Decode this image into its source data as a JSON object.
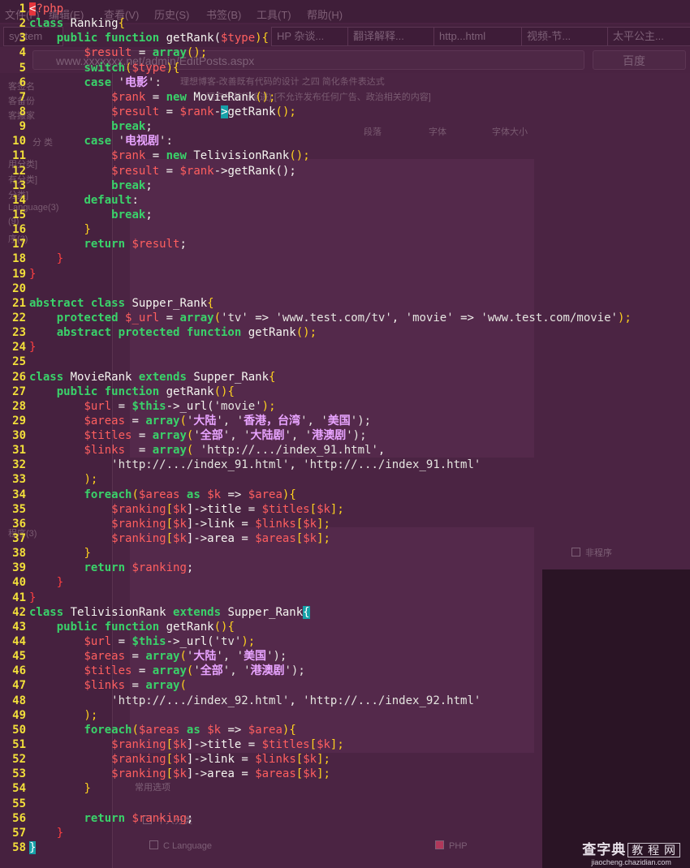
{
  "background": {
    "menus": [
      "文件(F)",
      "编辑(E)",
      "查看(V)",
      "历史(S)",
      "书签(B)",
      "工具(T)",
      "帮助(H)"
    ],
    "tabs": [
      "system",
      "HP 杂谈...",
      "翻译解释...",
      "http...html",
      "视频-节...",
      "太平公主..."
    ],
    "url": "www.xxxxxxx.net/admin/EditPosts.aspx",
    "search_placeholder": "百度",
    "sidebar_items": [
      "客签名",
      "客备份",
      "客搬家",
      "分    类",
      "用分类]",
      "有分类]",
      "分类]",
      "Language(3)",
      "(9)",
      "序(3)",
      "程序(3)"
    ],
    "editor_title": "理想博客-改善既有代码的设计 之四 简化条件表达式",
    "editor_notice": "理产生首行缩进) [不允许发布任何广告、政治相关的内容]",
    "editor_dropdowns": [
      "段落",
      "字体",
      "字体大小"
    ],
    "options_heading": "常用选项",
    "options": [
      "非程序",
      "个人分类",
      "C Language",
      "PHP"
    ]
  },
  "code_lines": [
    {
      "n": "1"
    },
    {
      "n": "2"
    },
    {
      "n": "3"
    },
    {
      "n": "4"
    },
    {
      "n": "5"
    },
    {
      "n": "6"
    },
    {
      "n": "7"
    },
    {
      "n": "8"
    },
    {
      "n": "9"
    },
    {
      "n": "10"
    },
    {
      "n": "11"
    },
    {
      "n": "12"
    },
    {
      "n": "13"
    },
    {
      "n": "14"
    },
    {
      "n": "15"
    },
    {
      "n": "16"
    },
    {
      "n": "17"
    },
    {
      "n": "18"
    },
    {
      "n": "19"
    },
    {
      "n": "20"
    },
    {
      "n": "21"
    },
    {
      "n": "22"
    },
    {
      "n": "23"
    },
    {
      "n": "24"
    },
    {
      "n": "25"
    },
    {
      "n": "26"
    },
    {
      "n": "27"
    },
    {
      "n": "28"
    },
    {
      "n": "29"
    },
    {
      "n": "30"
    },
    {
      "n": "31"
    },
    {
      "n": "32"
    },
    {
      "n": "33"
    },
    {
      "n": "34"
    },
    {
      "n": "35"
    },
    {
      "n": "36"
    },
    {
      "n": "37"
    },
    {
      "n": "38"
    },
    {
      "n": "39"
    },
    {
      "n": "40"
    },
    {
      "n": "41"
    },
    {
      "n": "42"
    },
    {
      "n": "43"
    },
    {
      "n": "44"
    },
    {
      "n": "45"
    },
    {
      "n": "46"
    },
    {
      "n": "47"
    },
    {
      "n": "48"
    },
    {
      "n": "49"
    },
    {
      "n": "50"
    },
    {
      "n": "51"
    },
    {
      "n": "52"
    },
    {
      "n": "53"
    },
    {
      "n": "54"
    },
    {
      "n": "55"
    },
    {
      "n": "56"
    },
    {
      "n": "57"
    },
    {
      "n": "58"
    }
  ],
  "code": {
    "l1": [
      "<",
      "?php"
    ],
    "l2": [
      "class ",
      "Ranking",
      "{"
    ],
    "l3": [
      "    ",
      "public function ",
      "getRank(",
      "$type",
      "){"
    ],
    "l4": [
      "        ",
      "$result",
      " = ",
      "array",
      "();"
    ],
    "l5": [
      "        ",
      "switch",
      "(",
      "$type",
      "){"
    ],
    "l6": [
      "        ",
      "case ",
      "'",
      "电影",
      "':"
    ],
    "l7": [
      "            ",
      "$rank",
      " = ",
      "new ",
      "MovieRank",
      "();"
    ],
    "l8": [
      "            ",
      "$result",
      " = ",
      "$rank",
      "-",
      ">",
      "getRank",
      "();"
    ],
    "l9": [
      "            ",
      "break",
      ";"
    ],
    "l10": [
      "        ",
      "case ",
      "'",
      "电视剧",
      "':"
    ],
    "l11": [
      "            ",
      "$rank",
      " = ",
      "new ",
      "TelivisionRank",
      "();"
    ],
    "l12": [
      "            ",
      "$result",
      " = ",
      "$rank",
      "->getRank();"
    ],
    "l13": [
      "            ",
      "break",
      ";"
    ],
    "l14": [
      "        ",
      "default",
      ":"
    ],
    "l15": [
      "            ",
      "break",
      ";"
    ],
    "l16": [
      "        ",
      "}"
    ],
    "l17": [
      "        ",
      "return ",
      "$result",
      ";"
    ],
    "l18": [
      "    ",
      "}"
    ],
    "l19": [
      "}"
    ],
    "l20": [
      ""
    ],
    "l21": [
      "abstract class ",
      "Supper_Rank",
      "{"
    ],
    "l22": [
      "    ",
      "protected ",
      "$_url",
      " = ",
      "array",
      "(",
      "'tv'",
      " => ",
      "'www.test.com/tv'",
      ", ",
      "'movie'",
      " => ",
      "'www.test.com/movie'",
      ");"
    ],
    "l23": [
      "    ",
      "abstract protected function ",
      "getRank",
      "();"
    ],
    "l24": [
      "}"
    ],
    "l25": [
      ""
    ],
    "l26": [
      "class ",
      "MovieRank ",
      "extends ",
      "Supper_Rank",
      "{"
    ],
    "l27": [
      "    ",
      "public function ",
      "getRank",
      "(){"
    ],
    "l28": [
      "        ",
      "$url",
      " = ",
      "$this",
      "->_url(",
      "'movie'",
      ");"
    ],
    "l29": [
      "        ",
      "$areas",
      " = ",
      "array",
      "(",
      "'",
      "大陆",
      "', '",
      "香港，台湾",
      "', '",
      "美国",
      "');"
    ],
    "l30": [
      "        ",
      "$titles",
      " = ",
      "array",
      "(",
      "'",
      "全部",
      "', '",
      "大陆剧",
      "', '",
      "港澳剧",
      "');"
    ],
    "l31": [
      "        ",
      "$links",
      "  = ",
      "array",
      "( ",
      "'http://.../index_91.html'",
      ","
    ],
    "l32": [
      "            ",
      "'http://.../index_91.html'",
      ", ",
      "'http://.../index_91.html'"
    ],
    "l33": [
      "        ",
      ");"
    ],
    "l34": [
      "        ",
      "foreach",
      "(",
      "$areas",
      " as ",
      "$k",
      " => ",
      "$area",
      "){"
    ],
    "l35": [
      "            ",
      "$ranking",
      "[",
      "$k",
      "]->title = ",
      "$titles",
      "[",
      "$k",
      "];"
    ],
    "l36": [
      "            ",
      "$ranking",
      "[",
      "$k",
      "]->link = ",
      "$links",
      "[",
      "$k",
      "];"
    ],
    "l37": [
      "            ",
      "$ranking",
      "[",
      "$k",
      "]->area = ",
      "$areas",
      "[",
      "$k",
      "];"
    ],
    "l38": [
      "        ",
      "}"
    ],
    "l39": [
      "        ",
      "return ",
      "$ranking",
      ";"
    ],
    "l40": [
      "    ",
      "}"
    ],
    "l41": [
      "}"
    ],
    "l42": [
      "class ",
      "TelivisionRank ",
      "extends ",
      "Supper_Rank",
      "{"
    ],
    "l43": [
      "    ",
      "public function ",
      "getRank",
      "(){"
    ],
    "l44": [
      "        ",
      "$url",
      " = ",
      "$this",
      "->_url(",
      "'tv'",
      ");"
    ],
    "l45": [
      "        ",
      "$areas",
      " = ",
      "array",
      "(",
      "'",
      "大陆",
      "', '",
      "美国",
      "');"
    ],
    "l46": [
      "        ",
      "$titles",
      " = ",
      "array",
      "(",
      "'",
      "全部",
      "', '",
      "港澳剧",
      "');"
    ],
    "l47": [
      "        ",
      "$links",
      " = ",
      "array",
      "("
    ],
    "l48": [
      "            ",
      "'http://.../index_92.html'",
      ", ",
      "'http://.../index_92.html'"
    ],
    "l49": [
      "        ",
      ");"
    ],
    "l50": [
      "        ",
      "foreach",
      "(",
      "$areas",
      " as ",
      "$k",
      " => ",
      "$area",
      "){"
    ],
    "l51": [
      "            ",
      "$ranking",
      "[",
      "$k",
      "]->title = ",
      "$titles",
      "[",
      "$k",
      "];"
    ],
    "l52": [
      "            ",
      "$ranking",
      "[",
      "$k",
      "]->link = ",
      "$links",
      "[",
      "$k",
      "];"
    ],
    "l53": [
      "            ",
      "$ranking",
      "[",
      "$k",
      "]->area = ",
      "$areas",
      "[",
      "$k",
      "];"
    ],
    "l54": [
      "        ",
      "}"
    ],
    "l55": [
      ""
    ],
    "l56": [
      "        ",
      "return ",
      "$ranking",
      ";"
    ],
    "l57": [
      "    ",
      "}"
    ],
    "l58": [
      "}"
    ]
  },
  "watermark": {
    "brand": "查字典",
    "sub": "教 程 网",
    "url": "jiaocheng.chazidian.com"
  },
  "colors": {
    "keyword": "#3ad26a",
    "variable": "#ff5f5f",
    "paren": "#ffd21e",
    "chinese": "#e8a4ff",
    "line_number": "#f2df3a",
    "background": "#3b1a34"
  }
}
